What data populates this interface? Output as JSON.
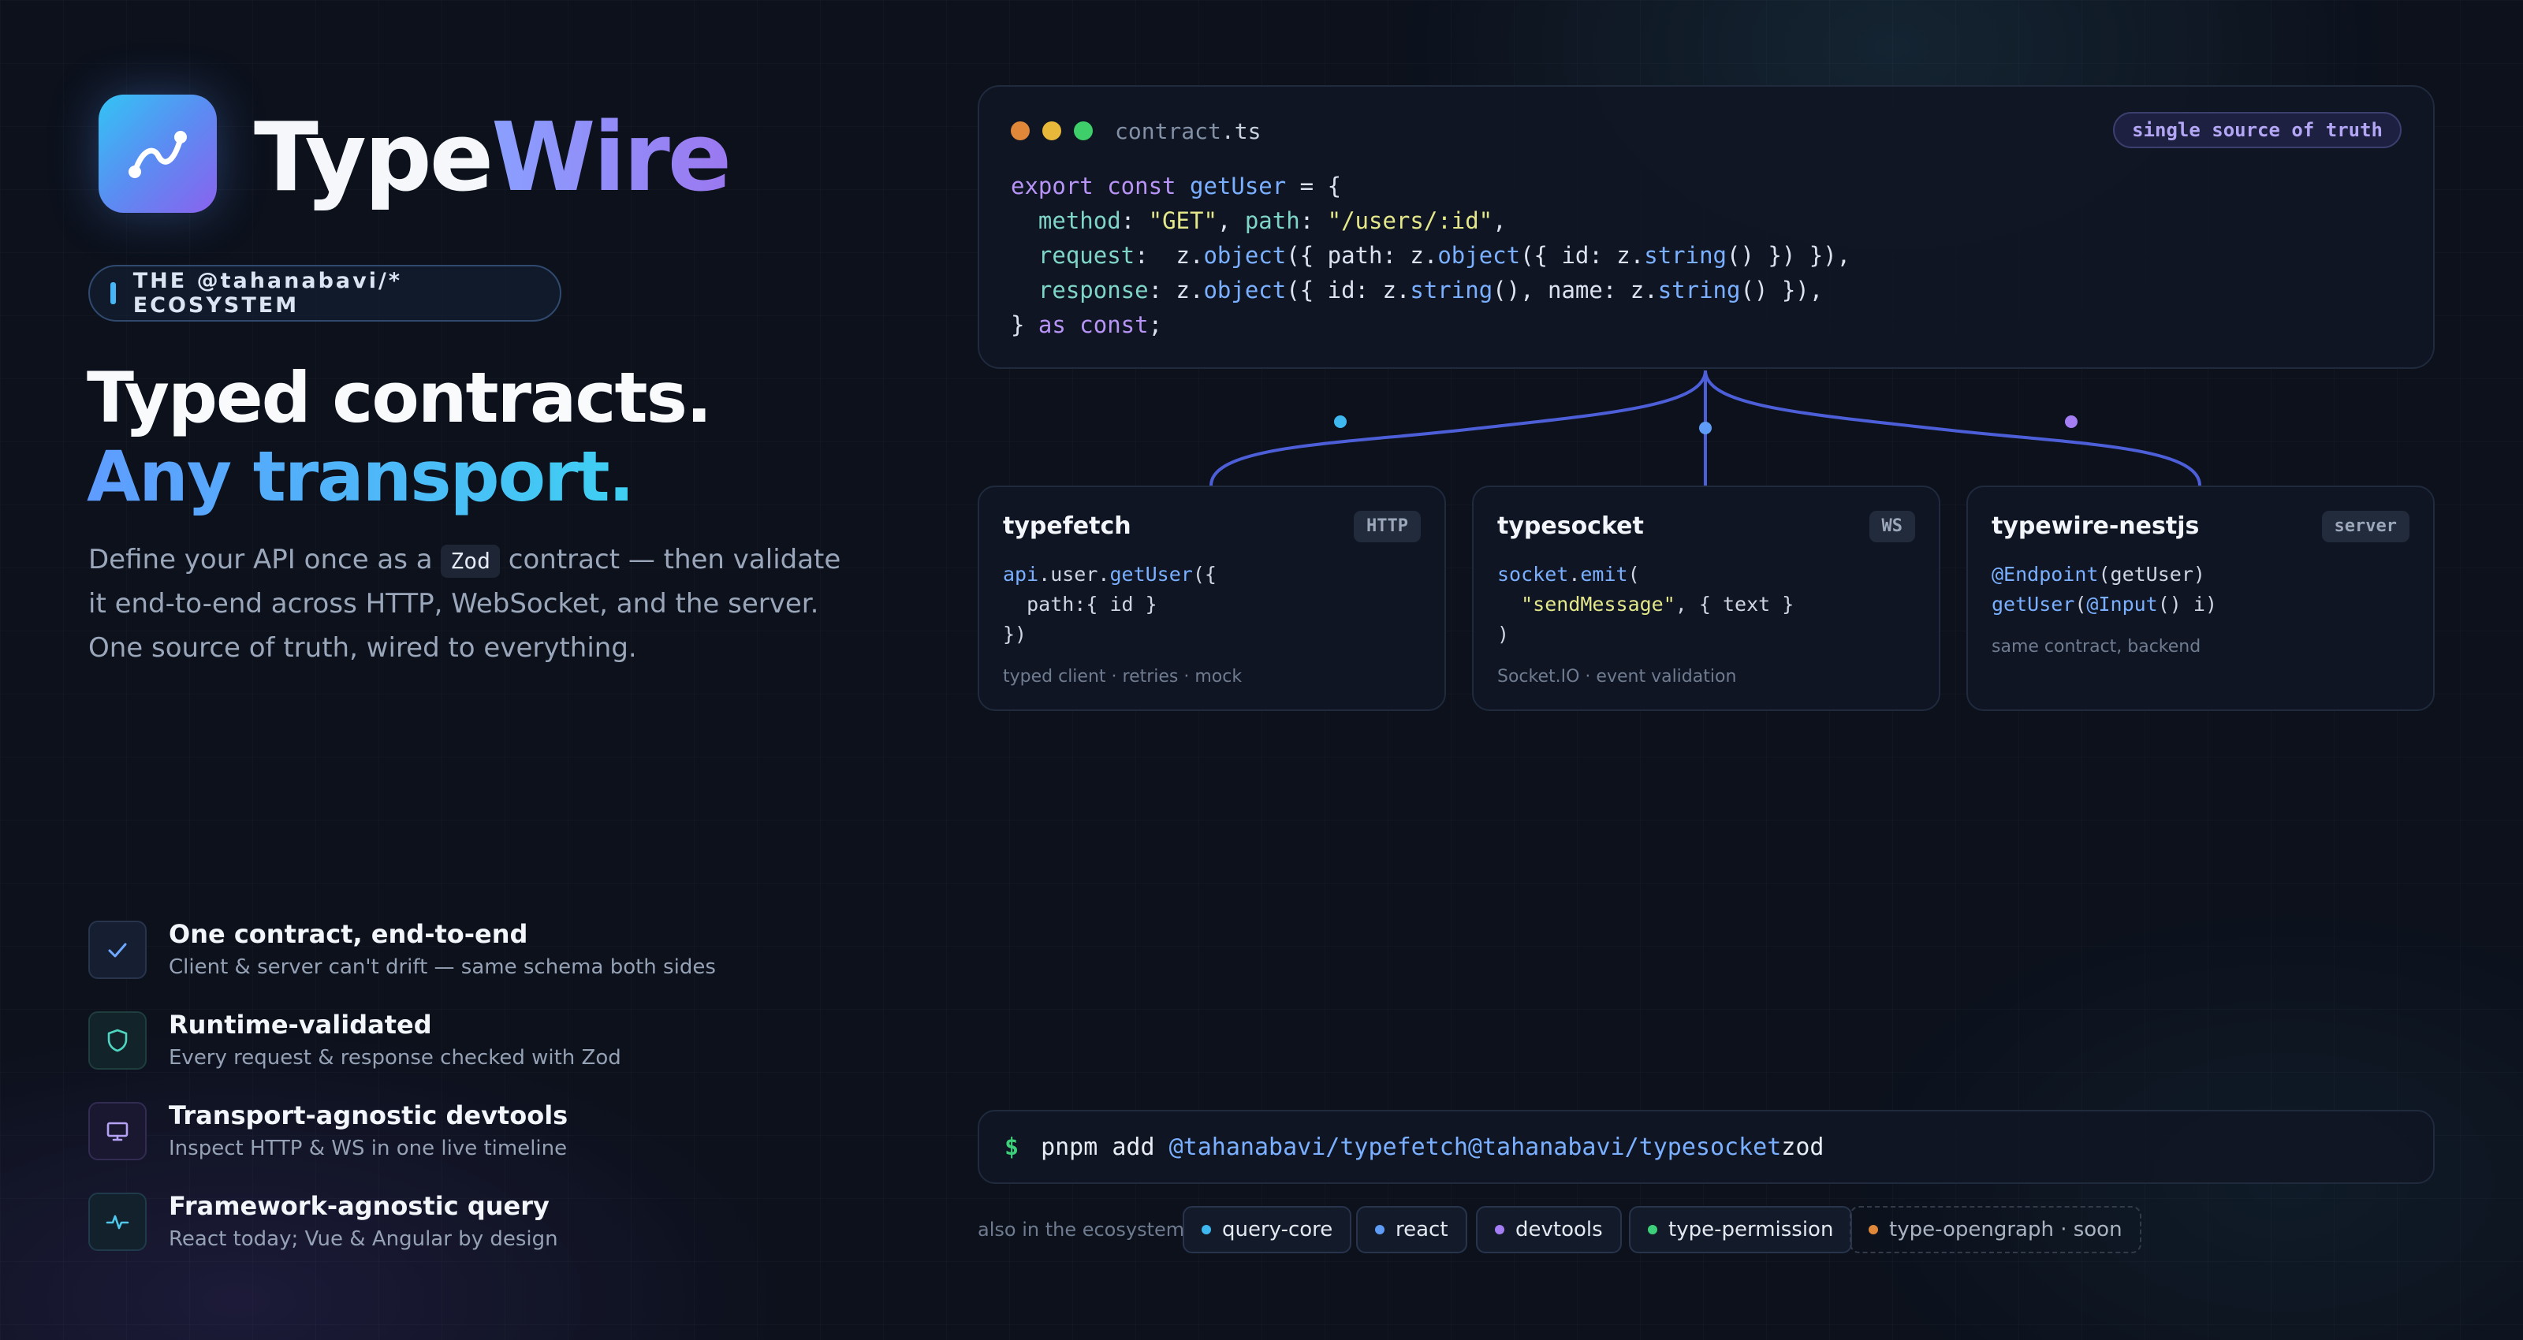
{
  "brand": {
    "part1": "Type",
    "part2": "Wire"
  },
  "ecosystem_pill": "THE @tahanabavi/* ECOSYSTEM",
  "headline": {
    "line1": "Typed contracts.",
    "line2": "Any transport."
  },
  "description": {
    "before": "Define your API once as a ",
    "code": "Zod",
    "after": " contract — then validate it end-to-end across HTTP, WebSocket, and the server. One source of truth, wired to everything."
  },
  "features": [
    {
      "title": "One contract, end-to-end",
      "subtitle": "Client & server can't drift — same schema both sides",
      "icon": "check-icon"
    },
    {
      "title": "Runtime-validated",
      "subtitle": "Every request & response checked with Zod",
      "icon": "shield-icon"
    },
    {
      "title": "Transport-agnostic devtools",
      "subtitle": "Inspect HTTP & WS in one live timeline",
      "icon": "monitor-icon"
    },
    {
      "title": "Framework-agnostic query",
      "subtitle": "React today; Vue & Angular by design",
      "icon": "pulse-icon"
    }
  ],
  "code_window": {
    "filename_base": "contract",
    "filename_ext": ".ts",
    "badge": "single source of truth",
    "lines": {
      "l1": {
        "kw1": "export const ",
        "fn": "getUser",
        "rest": " = {"
      },
      "l2": {
        "p1": "method",
        "s1": "\"GET\"",
        "p2": "path",
        "s2": "\"/users/:id\""
      },
      "l3": {
        "p1": "request",
        "z1": "z",
        "o1": "object",
        "mid1": "({ path: ",
        "z2": "z",
        "o2": "object",
        "mid2": "({ id: ",
        "z3": "z",
        "s1": "string",
        "end": "() }) }),"
      },
      "l4": {
        "p1": "response",
        "z1": "z",
        "o1": "object",
        "mid1": "({ id: ",
        "z2": "z",
        "s1": "string",
        "mid2": "(), name: ",
        "z3": "z",
        "s2": "string",
        "end": "() }),"
      },
      "l5": {
        "b": "} ",
        "kw": "as const",
        "end": ";"
      }
    }
  },
  "cards": [
    {
      "name": "typefetch",
      "tag": "HTTP",
      "footer": "typed client · retries · mock",
      "code": {
        "obj": "api",
        "mid": ".user.",
        "fn": "getUser",
        "open": "({",
        "line2": "  path:{ id }",
        "line3": "})"
      }
    },
    {
      "name": "typesocket",
      "tag": "WS",
      "footer": "Socket.IO · event validation",
      "code": {
        "obj": "socket",
        "fn": "emit",
        "open": "(",
        "str": "\"sendMessage\"",
        "rest": ", { text }",
        "line3": ")"
      }
    },
    {
      "name": "typewire-nestjs",
      "tag": "server",
      "footer": "same contract, backend",
      "code": {
        "dec": "@Endpoint",
        "arg": "(getUser)",
        "fn": "getUser",
        "p1": "(",
        "dec2": "@Input",
        "p2": "() i)"
      }
    }
  ],
  "terminal": {
    "prompt": "$",
    "cmd": "pnpm add ",
    "pkg1": "@tahanabavi/typefetch",
    "pkg2": "@tahanabavi/typesocket",
    "tail": "zod"
  },
  "ecosystem": {
    "label": "also in the ecosystem",
    "chips": [
      {
        "label": "query-core",
        "color": "#3fb8f0"
      },
      {
        "label": "react",
        "color": "#5e9cf5"
      },
      {
        "label": "devtools",
        "color": "#a47ef2"
      },
      {
        "label": "type-permission",
        "color": "#3ecf7a"
      },
      {
        "label": "type-opengraph · soon",
        "color": "#e0873a"
      }
    ]
  },
  "colors": {
    "background": "#0c111c",
    "accent_blue": "#5e9cf5",
    "accent_cyan": "#3ed0f2",
    "accent_purple": "#9b78f0",
    "dot_red": "#e0873a",
    "dot_yellow": "#e8b83a",
    "dot_green": "#3ecf6a"
  }
}
